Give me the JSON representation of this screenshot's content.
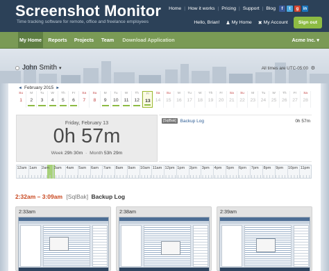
{
  "header": {
    "title": "Screenshot Monitor",
    "tagline": "Time tracking software for remote, office and freelance employees",
    "top_links": [
      "Home",
      "How it works",
      "Pricing",
      "Support",
      "Blog"
    ],
    "greeting": "Hello, Brian!",
    "my_home": "My Home",
    "my_account": "My Account",
    "sign_out": "Sign out"
  },
  "nav": {
    "tabs": [
      "My Home",
      "Reports",
      "Projects",
      "Team",
      "Download Application"
    ],
    "active_tab": "My Home",
    "account": "Acme Inc. ▾"
  },
  "user": {
    "name": "John Smith",
    "caret": "▾"
  },
  "timezone": "All times are UTC-05:00",
  "calendar": {
    "month_label": "February 2015",
    "prev": "◄",
    "next": "►",
    "selected_day": 13,
    "days": [
      {
        "dn": "Su",
        "n": 1,
        "bar": 0
      },
      {
        "dn": "M",
        "n": 2,
        "bar": 1
      },
      {
        "dn": "Tu",
        "n": 3,
        "bar": 1
      },
      {
        "dn": "W",
        "n": 4,
        "bar": 1
      },
      {
        "dn": "Th",
        "n": 5,
        "bar": 1
      },
      {
        "dn": "Fr",
        "n": 6,
        "bar": 1
      },
      {
        "dn": "Sa",
        "n": 7,
        "bar": 0
      },
      {
        "dn": "Su",
        "n": 8,
        "bar": 0
      },
      {
        "dn": "M",
        "n": 9,
        "bar": 1
      },
      {
        "dn": "Tu",
        "n": 10,
        "bar": 1
      },
      {
        "dn": "W",
        "n": 11,
        "bar": 1
      },
      {
        "dn": "Th",
        "n": 12,
        "bar": 1
      },
      {
        "dn": "Fr",
        "n": 13,
        "bar": 1
      },
      {
        "dn": "Sa",
        "n": 14,
        "bar": 0
      },
      {
        "dn": "Su",
        "n": 15,
        "bar": 0
      },
      {
        "dn": "M",
        "n": 16,
        "bar": 0
      },
      {
        "dn": "Tu",
        "n": 17,
        "bar": 0
      },
      {
        "dn": "W",
        "n": 18,
        "bar": 0
      },
      {
        "dn": "Th",
        "n": 19,
        "bar": 0
      },
      {
        "dn": "Fr",
        "n": 20,
        "bar": 0
      },
      {
        "dn": "Sa",
        "n": 21,
        "bar": 0
      },
      {
        "dn": "Su",
        "n": 22,
        "bar": 0
      },
      {
        "dn": "M",
        "n": 23,
        "bar": 0
      },
      {
        "dn": "Tu",
        "n": 24,
        "bar": 0
      },
      {
        "dn": "W",
        "n": 25,
        "bar": 0
      },
      {
        "dn": "Th",
        "n": 26,
        "bar": 0
      },
      {
        "dn": "Fr",
        "n": 27,
        "bar": 0
      },
      {
        "dn": "Sa",
        "n": 28,
        "bar": 0
      }
    ]
  },
  "stats": {
    "date": "Friday, February 13",
    "total": "0h 57m",
    "week_label": "Week",
    "week_value": "29h 30m",
    "month_label": "Month",
    "month_value": "53h 29m"
  },
  "activity": {
    "tag": "[SqlBak]",
    "title": "Backup Log",
    "duration": "0h 57m"
  },
  "timeline": {
    "hours": [
      "12am",
      "1am",
      "2am",
      "3am",
      "4am",
      "5am",
      "6am",
      "7am",
      "8am",
      "9am",
      "10am",
      "11am",
      "12pm",
      "1pm",
      "2pm",
      "3pm",
      "4pm",
      "5pm",
      "6pm",
      "7pm",
      "8pm",
      "9pm",
      "10pm",
      "11pm"
    ],
    "active_start_hour": 2.53,
    "active_end_hour": 3.15
  },
  "session": {
    "range": "2:32am – 3:09am",
    "tag": "[SqlBak]",
    "name": "Backup Log",
    "shots": [
      "2:33am",
      "2:38am",
      "2:39am"
    ]
  },
  "colors": {
    "header": "#2c4158",
    "nav": "#7a9a55",
    "accent_green": "#8dbb43",
    "range_orange": "#c8461e",
    "weekend_red": "#c24141"
  }
}
